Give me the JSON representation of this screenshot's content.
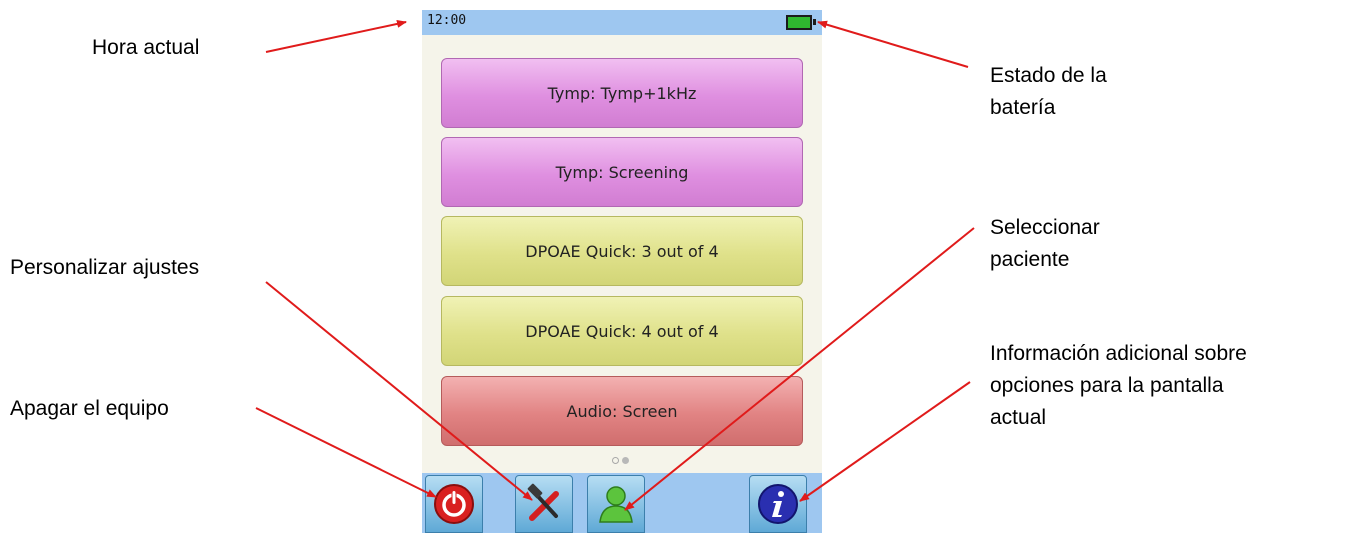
{
  "status_bar": {
    "time": "12:00",
    "battery_color": "#2fb82f"
  },
  "test_buttons": [
    {
      "label": "Tymp: Tymp+1kHz",
      "color": "#df8fe0"
    },
    {
      "label": "Tymp: Screening",
      "color": "#df8fe0"
    },
    {
      "label": "DPOAE Quick: 3 out of 4",
      "color": "#dfe18a"
    },
    {
      "label": "DPOAE Quick: 4 out of 4",
      "color": "#dfe18a"
    },
    {
      "label": "Audio: Screen",
      "color": "#e18383"
    }
  ],
  "page_indicator": {
    "pages": 2,
    "current": 2
  },
  "toolbar": {
    "icons": [
      "power-icon",
      "tools-icon",
      "patient-icon",
      "info-icon"
    ]
  },
  "callouts": {
    "current_time": "Hora actual",
    "customize_settings": "Personalizar ajustes",
    "power_off": "Apagar el equipo",
    "battery_state_line1": "Estado de la",
    "battery_state_line2": "batería",
    "select_patient_line1": "Seleccionar",
    "select_patient_line2": "paciente",
    "extra_info_line1": "Información adicional sobre",
    "extra_info_line2": "opciones para la pantalla",
    "extra_info_line3": "actual"
  },
  "arrow_color": "#e01b1b"
}
